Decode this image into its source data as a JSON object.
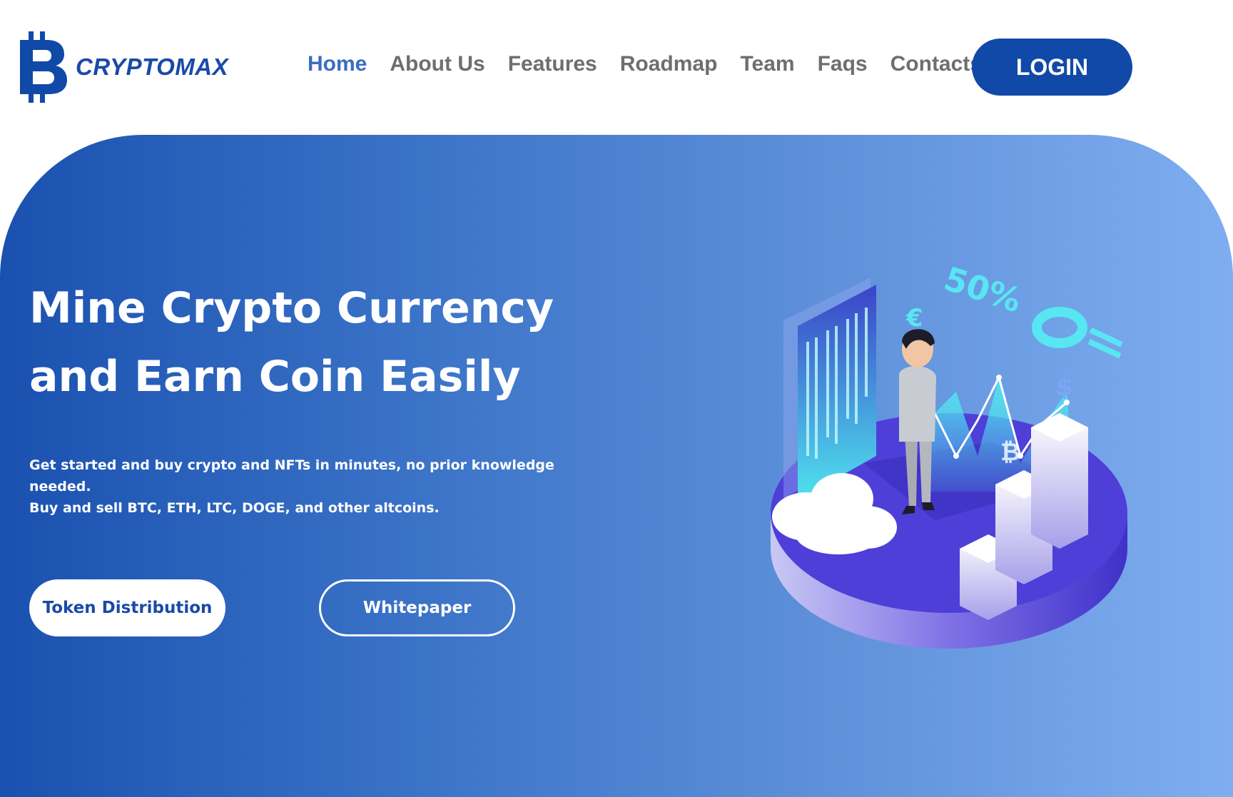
{
  "header": {
    "brand": "CRYPTOMAX",
    "nav": [
      {
        "label": "Home",
        "active": true
      },
      {
        "label": "About Us",
        "active": false
      },
      {
        "label": "Features",
        "active": false
      },
      {
        "label": "Roadmap",
        "active": false
      },
      {
        "label": "Team",
        "active": false
      },
      {
        "label": "Faqs",
        "active": false
      },
      {
        "label": "Contacts",
        "active": false
      }
    ],
    "login_label": "LOGIN"
  },
  "hero": {
    "title_line1": "Mine Crypto Currency",
    "title_line2": "and Earn Coin Easily",
    "subtitle_line1": "Get started and buy crypto and NFTs in minutes, no prior knowledge needed.",
    "subtitle_line2": "Buy and sell BTC, ETH, LTC, DOGE, and other altcoins.",
    "primary_button": "Token Distribution",
    "secondary_button": "Whitepaper"
  },
  "illustration": {
    "percent_label": "50%",
    "euro_symbol": "€",
    "dollar_symbol": "$",
    "bitcoin_symbol": "₿",
    "icon": "crypto-mining-isometric-illustration"
  },
  "colors": {
    "brand_blue": "#1149a8",
    "nav_active": "#3a6cc0",
    "nav_text": "#6e6e6e",
    "hero_gradient_start": "#1a51b0",
    "hero_gradient_end": "#7fadf0"
  }
}
